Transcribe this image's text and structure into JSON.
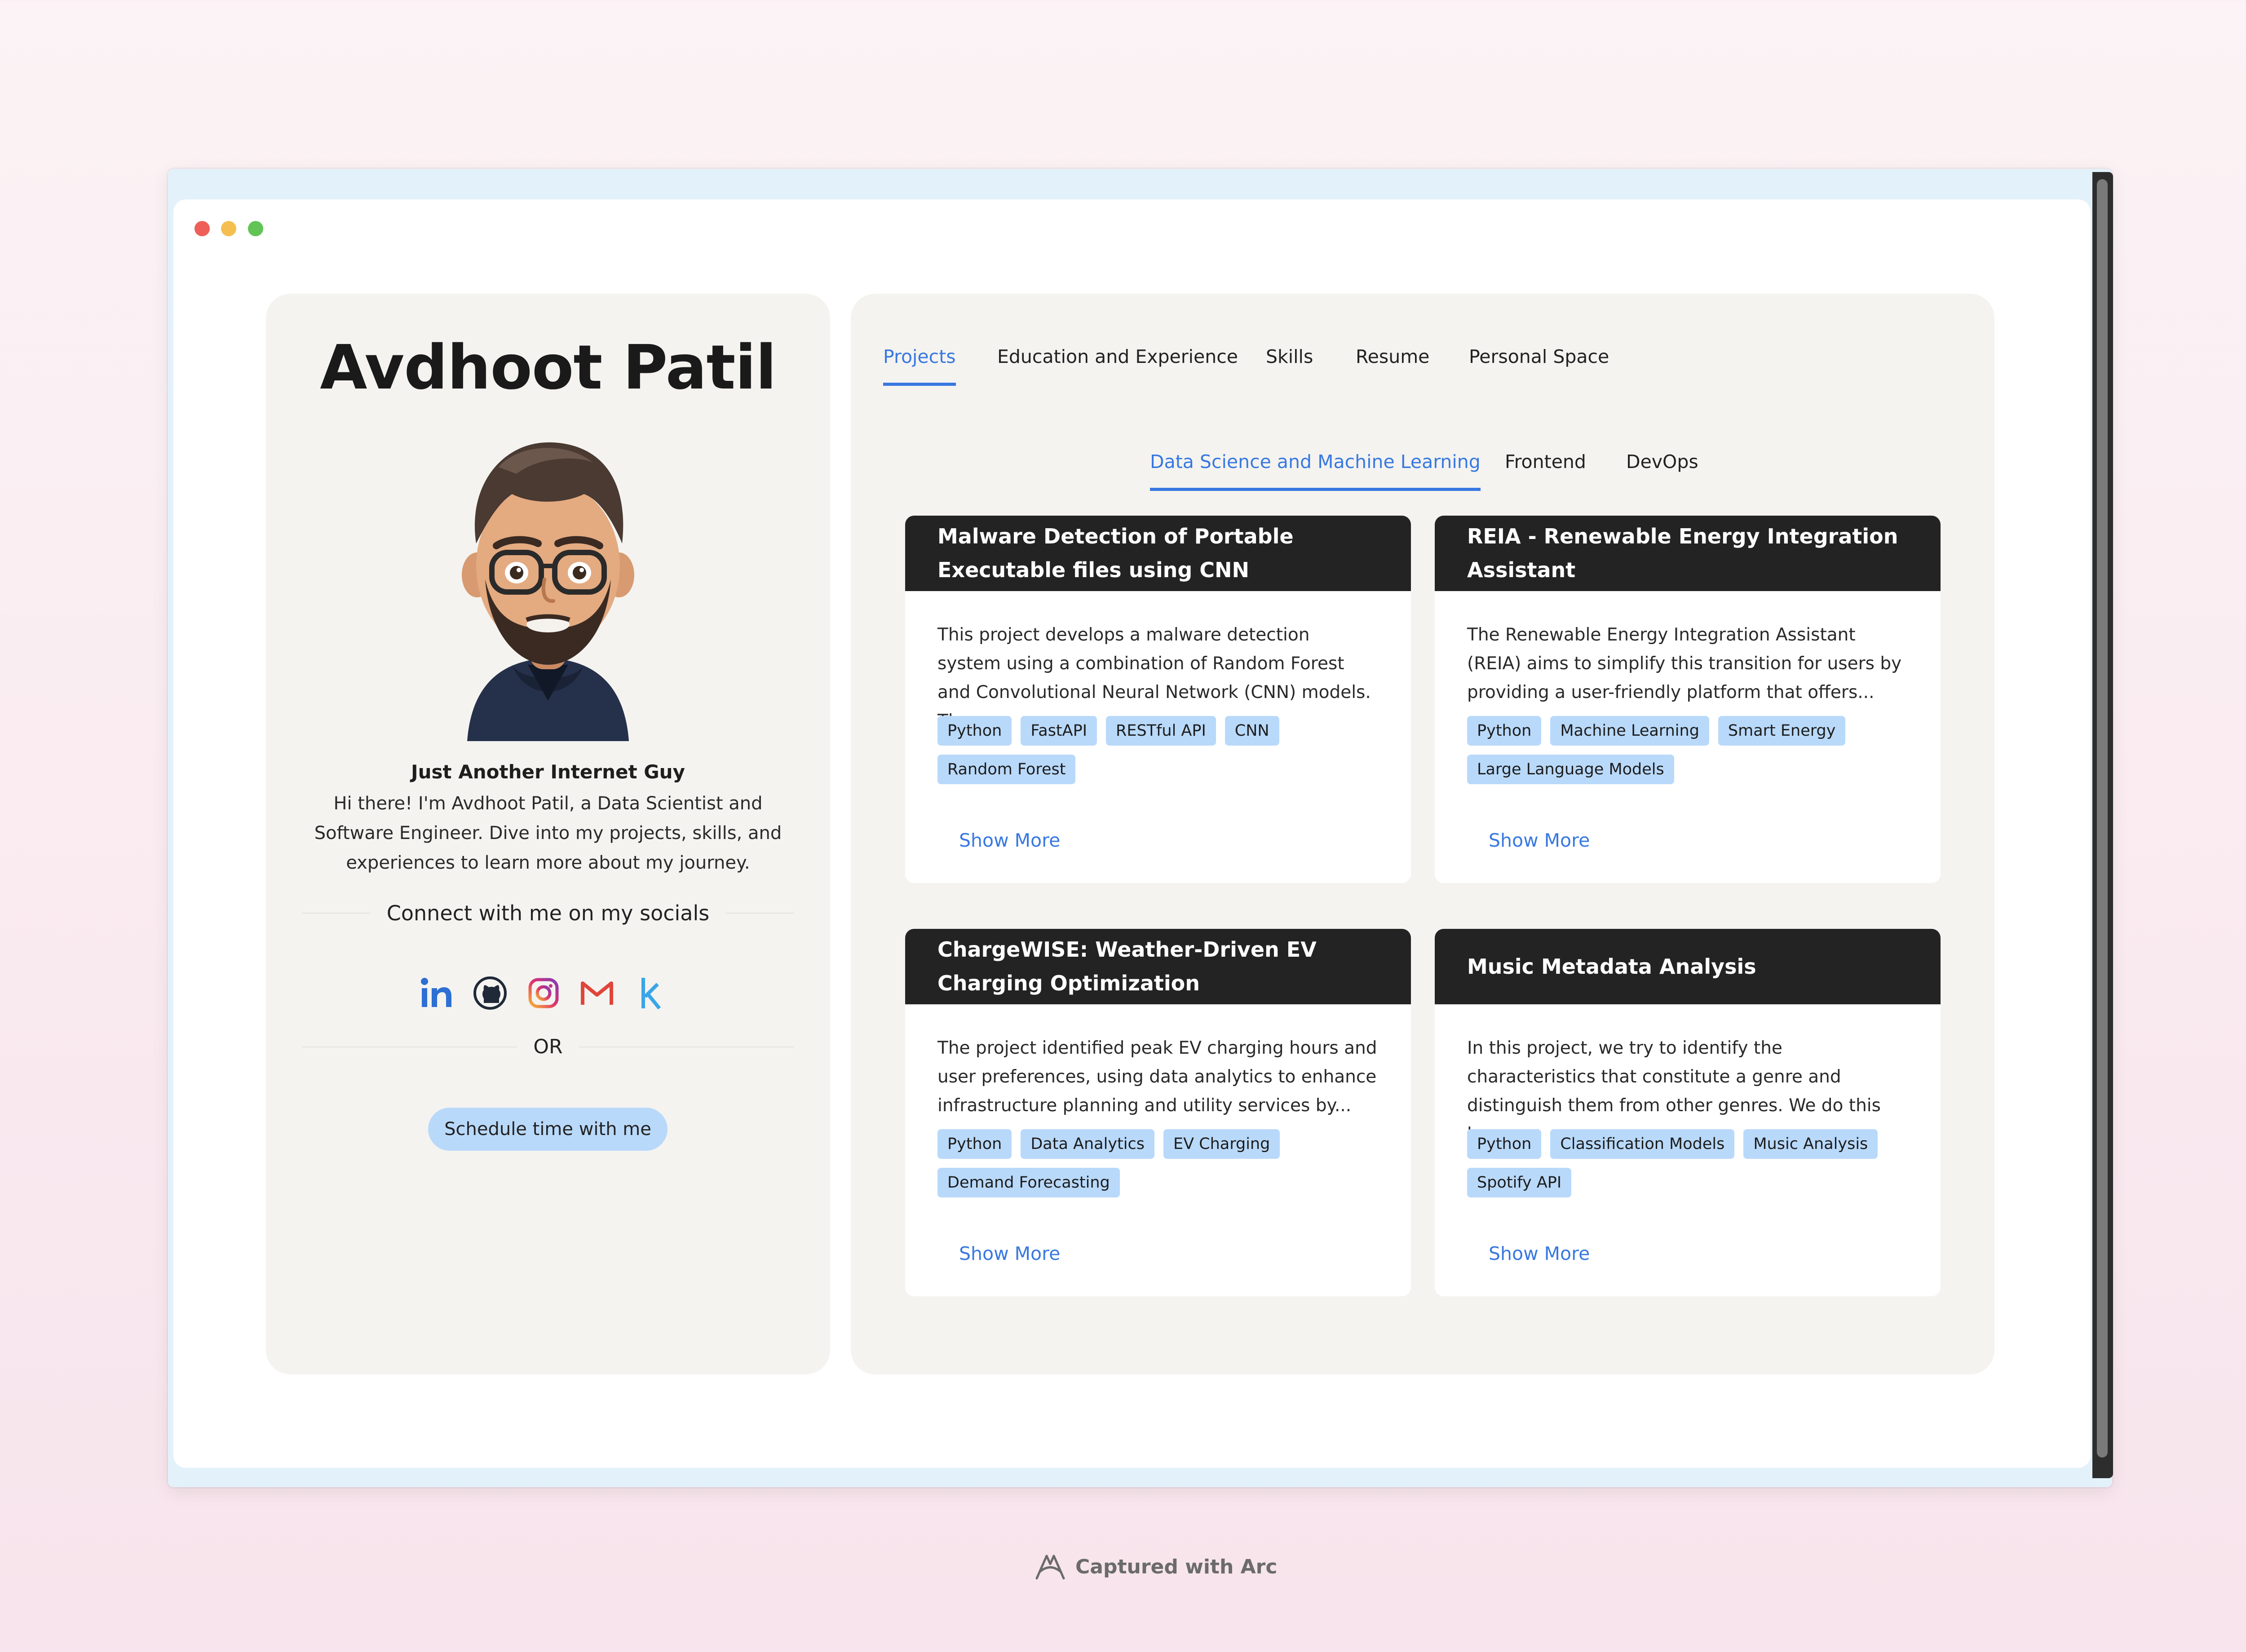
{
  "profile": {
    "name": "Avdhoot Patil",
    "tagline": "Just Another Internet Guy",
    "bio": "Hi there! I'm Avdhoot Patil, a Data Scientist and Software Engineer. Dive into my projects, skills, and experiences to learn more about my journey.",
    "connect_label": "Connect with me on my socials",
    "socials": [
      "linkedin-icon",
      "github-icon",
      "instagram-icon",
      "gmail-icon",
      "kaggle-icon"
    ],
    "or_label": "OR",
    "schedule_label": "Schedule time with me"
  },
  "tabs": [
    "Projects",
    "Education and Experience",
    "Skills",
    "Resume",
    "Personal Space"
  ],
  "active_tab": "Projects",
  "subtabs": [
    "Data Science and Machine Learning",
    "Frontend",
    "DevOps"
  ],
  "active_subtab": "Data Science and Machine Learning",
  "projects": [
    {
      "title": "Malware Detection of Portable Executable files using CNN",
      "description": "This project develops a malware detection system using a combination of Random Forest and Convolutional Neural Network (CNN) models. Th...",
      "tags": [
        "Python",
        "FastAPI",
        "RESTful API",
        "CNN",
        "Random Forest"
      ],
      "show_more": "Show More"
    },
    {
      "title": "REIA - Renewable Energy Integration Assistant",
      "description": "The Renewable Energy Integration Assistant (REIA) aims to simplify this transition for users by providing a user-friendly platform that offers...",
      "tags": [
        "Python",
        "Machine Learning",
        "Smart Energy",
        "Large Language Models"
      ],
      "show_more": "Show More"
    },
    {
      "title": "ChargeWISE: Weather-Driven EV Charging Optimization",
      "description": "The project identified peak EV charging hours and user preferences, using data analytics to enhance infrastructure planning and utility services by...",
      "tags": [
        "Python",
        "Data Analytics",
        "EV Charging",
        "Demand Forecasting"
      ],
      "show_more": "Show More"
    },
    {
      "title": "Music Metadata Analysis",
      "description": "In this project, we try to identify the characteristics that constitute a genre and distinguish them from other genres. We do this b...",
      "tags": [
        "Python",
        "Classification Models",
        "Music Analysis",
        "Spotify API"
      ],
      "show_more": "Show More"
    }
  ],
  "footer": {
    "label": "Captured with Arc"
  },
  "colors": {
    "accent": "#3878e0",
    "tag": "#b9d9fa",
    "card_header": "#232323"
  }
}
